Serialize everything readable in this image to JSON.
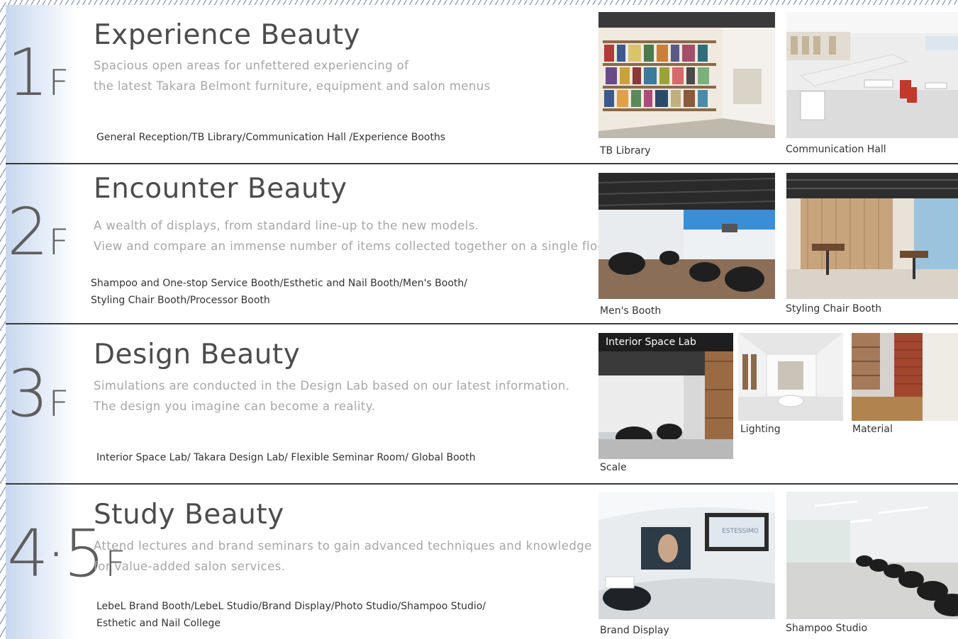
{
  "floors": [
    {
      "number": "1",
      "suffix": "F",
      "title": "Experience Beauty",
      "description": [
        "Spacious open areas for unfettered experiencing of",
        "the latest Takara Belmont furniture, equipment and salon menus"
      ],
      "rooms": [
        "General Reception/TB Library/Communication Hall /Experience Booths"
      ],
      "photos": [
        {
          "caption": "TB Library"
        },
        {
          "caption": "Communication Hall"
        }
      ]
    },
    {
      "number": "2",
      "suffix": "F",
      "title": "Encounter Beauty",
      "description": [
        "A wealth of displays, from standard line-up to the new models.",
        "View and compare an immense number of items collected together on a single floor."
      ],
      "rooms": [
        "Shampoo and One-stop Service Booth/Esthetic and Nail Booth/Men's Booth/",
        "Styling Chair Booth/Processor Booth"
      ],
      "photos": [
        {
          "caption": "Men's Booth"
        },
        {
          "caption": "Styling Chair Booth"
        }
      ]
    },
    {
      "number": "3",
      "suffix": "F",
      "title": "Design Beauty",
      "description": [
        "Simulations are conducted in the Design Lab based on our latest information.",
        "The design you imagine can become a reality."
      ],
      "rooms": [
        "Interior Space Lab/ Takara Design Lab/ Flexible Seminar Room/ Global Booth"
      ],
      "photos": [
        {
          "caption": "Scale",
          "tag": "Interior Space Lab"
        },
        {
          "caption": "Lighting"
        },
        {
          "caption": "Material"
        }
      ]
    },
    {
      "number": "4·5",
      "suffix": "F",
      "title": "Study Beauty",
      "description": [
        "Attend lectures and brand seminars to gain advanced techniques and knowledge",
        "for value-added salon services."
      ],
      "rooms": [
        "LebeL Brand Booth/LebeL Studio/Brand Display/Photo Studio/Shampoo Studio/",
        "Esthetic and Nail College"
      ],
      "photos": [
        {
          "caption": "Brand Display",
          "sign": "ESTESSIMO"
        },
        {
          "caption": "Shampoo Studio"
        }
      ]
    }
  ]
}
